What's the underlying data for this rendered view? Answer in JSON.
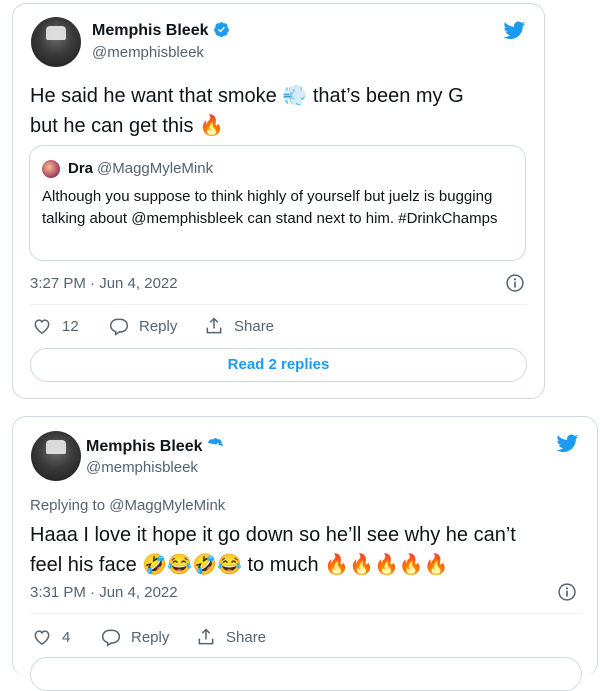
{
  "tweet1": {
    "author_name": "Memphis Bleek",
    "author_handle": "@memphisbleek",
    "text_line1": "He said he want that smoke",
    "text_emoji1": "💨",
    "text_line1_end": "that’s been my G",
    "text_line2": "but he can get this",
    "text_emoji2": "🔥",
    "quote": {
      "name": "Dra",
      "handle": "@MaggMyleMink",
      "text": "Although you suppose to think highly of yourself but juelz is bugging talking about @memphisbleek can stand next to him. #DrinkChamps"
    },
    "timestamp": "3:27 PM · Jun 4, 2022",
    "like_count": "12",
    "reply_label": "Reply",
    "share_label": "Share",
    "read_replies_label": "Read 2 replies"
  },
  "tweet2": {
    "author_name": "Memphis Bleek",
    "author_handle": "@memphisbleek",
    "replying_to_prefix": "Replying to",
    "replying_to_handle": "@MaggMyleMink",
    "text_line1": "Haaa I love it hope it go down so he’ll see why he can’t",
    "text_line2_start": "feel his face",
    "text_emojis_a": "🤣😂🤣😂",
    "text_line2_mid": "to much",
    "text_emojis_b": "🔥🔥🔥🔥🔥",
    "timestamp": "3:31 PM · Jun 4, 2022",
    "like_count": "4",
    "reply_label": "Reply",
    "share_label": "Share"
  },
  "colors": {
    "twitter_blue": "#1d9bf0",
    "secondary_text": "#536471",
    "border": "#cfd9de"
  },
  "icons": [
    "verified-badge-icon",
    "twitter-bird-icon",
    "info-icon",
    "heart-icon",
    "reply-bubble-icon",
    "share-icon"
  ]
}
